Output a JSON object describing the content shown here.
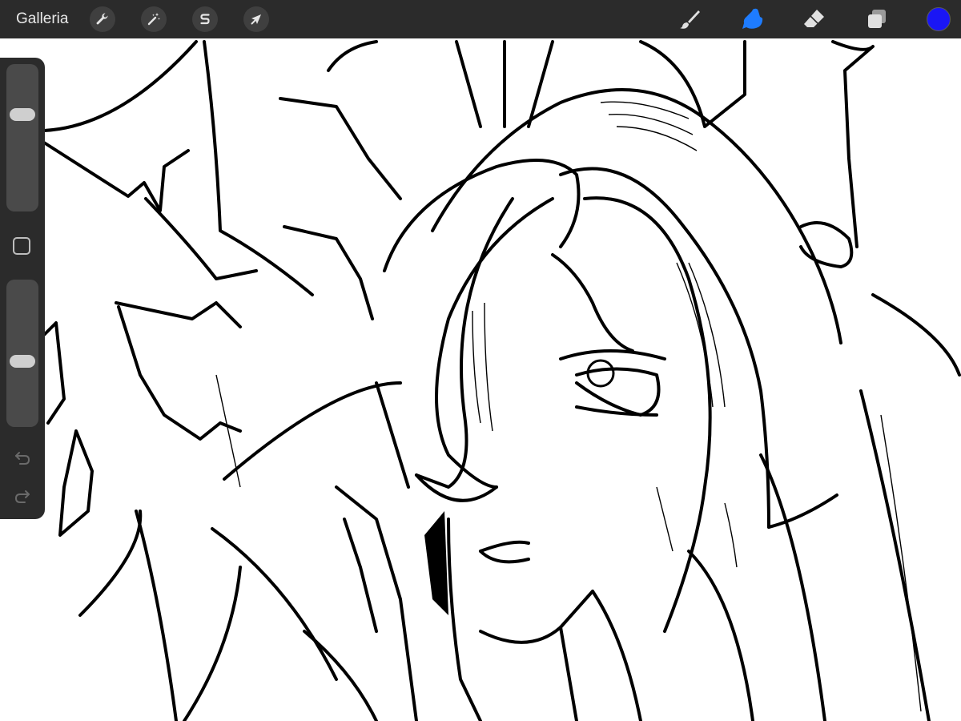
{
  "topbar": {
    "gallery_label": "Galleria",
    "left_tools": [
      {
        "name": "actions",
        "icon": "wrench-icon"
      },
      {
        "name": "adjustments",
        "icon": "magic-wand-icon"
      },
      {
        "name": "selection",
        "icon": "selection-s-icon"
      },
      {
        "name": "transform",
        "icon": "arrow-cursor-icon"
      }
    ],
    "right_tools": [
      {
        "name": "brush",
        "icon": "brush-icon",
        "active": false
      },
      {
        "name": "smudge",
        "icon": "smudge-finger-icon",
        "active": true
      },
      {
        "name": "eraser",
        "icon": "eraser-icon",
        "active": false
      },
      {
        "name": "layers",
        "icon": "layers-icon",
        "active": false
      }
    ],
    "active_tool_color": "#1e7cff",
    "current_color": "#1a16f5"
  },
  "sidebar": {
    "brush_size_level": 0.68,
    "opacity_level": 0.44,
    "icons": [
      "square-modifier-icon",
      "undo-icon",
      "redo-icon"
    ]
  },
  "canvas": {
    "background": "#ffffff",
    "ink": "#000000",
    "content": "line-art-illustration"
  }
}
